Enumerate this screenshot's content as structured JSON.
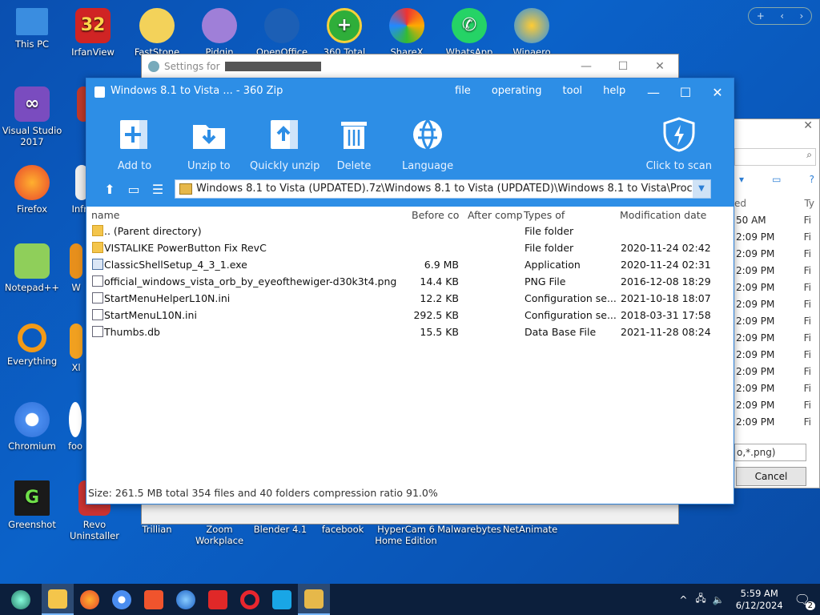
{
  "desktop": {
    "icons_left": [
      "This PC",
      "Visual Studio 2017",
      "Firefox",
      "Notepad++",
      "Everything",
      "Chromium",
      "Greenshot"
    ],
    "icons_col2": [
      "IrfanView",
      "W",
      "Infra",
      "W",
      "Xl",
      "foo",
      "Revo Uninstaller"
    ],
    "icons_top": [
      "FastStone Ima",
      "Pidgin",
      "OpenOffice",
      "360 Total",
      "ShareX",
      "WhatsApp",
      "Winaero"
    ],
    "icons_bottom": [
      "Trillian",
      "Zoom Workplace",
      "Blender 4.1",
      "facebook",
      "HyperCam 6 Home Edition",
      "Malwarebytes",
      "NetAnimate"
    ]
  },
  "settings_window": {
    "title": "Settings for"
  },
  "right_window": {
    "rows": [
      "50 AM",
      "2:09 PM",
      "2:09 PM",
      "2:09 PM",
      "2:09 PM",
      "2:09 PM",
      "2:09 PM",
      "2:09 PM",
      "2:09 PM",
      "2:09 PM",
      "2:09 PM",
      "2:09 PM",
      "2:09 PM"
    ],
    "col_head": "ed",
    "col_head2": "Ty",
    "filter": "o,*.png)",
    "cancel": "Cancel"
  },
  "zip": {
    "title": "Windows 8.1 to Vista ... - 360 Zip",
    "menu": [
      "file",
      "operating",
      "tool",
      "help"
    ],
    "toolbar": [
      "Add to",
      "Unzip to",
      "Quickly unzip",
      "Delete",
      "Language"
    ],
    "scan": "Click to scan",
    "path": "Windows 8.1 to Vista (UPDATED).7z\\Windows 8.1 to Vista (UPDATED)\\Windows 8.1 to Vista\\Proceed\\Start",
    "columns": {
      "name": "name",
      "before": "Before co",
      "after": "After comp",
      "type": "Types of",
      "date": "Modification date"
    },
    "files": [
      {
        "name": ".. (Parent directory)",
        "size": "",
        "type": "File folder",
        "date": ""
      },
      {
        "name": "VISTALIKE PowerButton Fix RevC",
        "size": "",
        "type": "File folder",
        "date": "2020-11-24 02:42"
      },
      {
        "name": "ClassicShellSetup_4_3_1.exe",
        "size": "6.9 MB",
        "type": "Application",
        "date": "2020-11-24 02:31"
      },
      {
        "name": "official_windows_vista_orb_by_eyeofthewiger-d30k3t4.png",
        "size": "14.4 KB",
        "type": "PNG File",
        "date": "2016-12-08 18:29"
      },
      {
        "name": "StartMenuHelperL10N.ini",
        "size": "12.2 KB",
        "type": "Configuration se...",
        "date": "2021-10-18 18:07"
      },
      {
        "name": "StartMenuL10N.ini",
        "size": "292.5 KB",
        "type": "Configuration se...",
        "date": "2018-03-31 17:58"
      },
      {
        "name": "Thumbs.db",
        "size": "15.5 KB",
        "type": "Data Base File",
        "date": "2021-11-28 08:24"
      }
    ],
    "status": "Size: 261.5 MB total 354 files and 40 folders compression ratio 91.0%"
  },
  "taskbar": {
    "time": "5:59 AM",
    "date": "6/12/2024",
    "notif": "2"
  }
}
